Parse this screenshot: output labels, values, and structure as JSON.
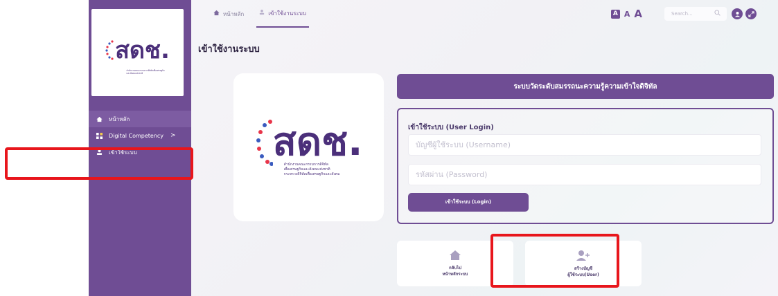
{
  "sidebar": {
    "logo": {
      "text": "สดช.",
      "caption": "สำนักงานคณะกรรมการดิจิทัลเพื่อเศรษฐกิจและสังคมแห่งชาติ"
    },
    "items": [
      {
        "label": "หน้าหลัก",
        "icon": "home-icon"
      },
      {
        "label": "Digital Competency",
        "icon": "grid-icon",
        "chevron": ">"
      },
      {
        "label": "เข้าใช้ระบบ",
        "icon": "user-icon"
      }
    ]
  },
  "topbar": {
    "breadcrumbs": [
      {
        "label": "หน้าหลัก",
        "icon": "home-icon"
      },
      {
        "label": "เข้าใช้งานระบบ",
        "icon": "user-icon"
      }
    ],
    "font_sizes": [
      "A",
      "A",
      "A"
    ],
    "search": {
      "placeholder": "Search..."
    }
  },
  "main": {
    "title": "เข้าใช้งานระบบ",
    "banner": "ระบบวัดระดับสมรรถนะความรู้ความเข้าใจดิจิทัล",
    "logo": {
      "text": "สดช.",
      "caption": [
        "สำนักงานคณะกรรมการดิจิทัล",
        "เพื่อเศรษฐกิจและสังคมแห่งชาติ",
        "กระทรวงดิจิทัลเพื่อเศรษฐกิจและสังคม"
      ]
    },
    "login": {
      "title": "เข้าใช้ระบบ (User Login)",
      "username_placeholder": "บัญชีผู้ใช้ระบบ (Username)",
      "password_placeholder": "รหัสผ่าน (Password)",
      "button": "เข้าใช้ระบบ (Login)"
    },
    "cards": [
      {
        "line1": "กลับไป",
        "line2": "หน้าหลักระบบ",
        "icon": "home-icon"
      },
      {
        "line1": "สร้างบัญชี",
        "line2": "ผู้ใช้ระบบ(User)",
        "icon": "add-user-icon"
      }
    ]
  },
  "colors": {
    "brand": "#6f4d94",
    "highlight": "#e8161c"
  }
}
